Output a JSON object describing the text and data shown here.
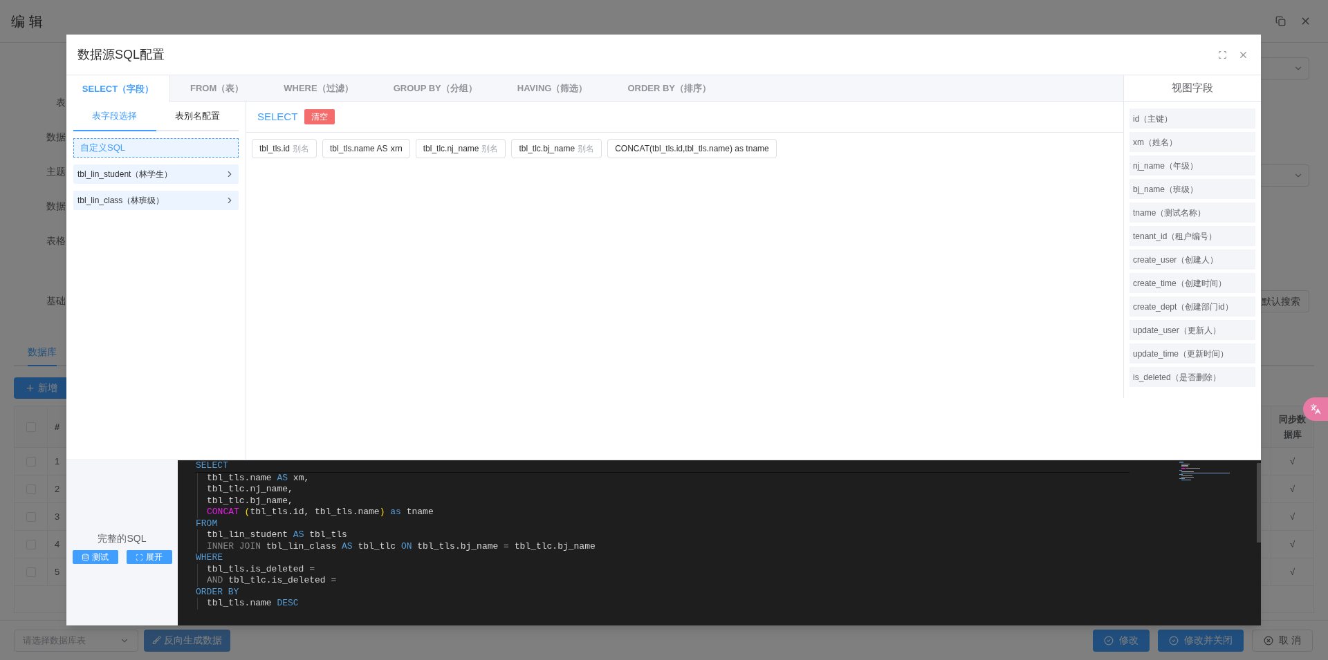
{
  "page": {
    "title": "编 辑",
    "form_labels": [
      "表",
      "数据",
      "主题",
      "数据",
      "表格",
      "基础"
    ],
    "default_search_button": "默认搜索",
    "tabs": [
      {
        "label": "数据库",
        "selected": true
      }
    ],
    "add_button": "新增",
    "table": {
      "header_checkbox": {
        "checked": false
      },
      "columns": [
        "#",
        "同步数据库"
      ],
      "rows": [
        {
          "checked": false,
          "number": "1",
          "sync": "√"
        },
        {
          "checked": false,
          "number": "2",
          "sync": "√"
        },
        {
          "checked": false,
          "number": "3",
          "sync": "√"
        },
        {
          "checked": false,
          "number": "4",
          "sync": "√"
        },
        {
          "checked": false,
          "number": "5",
          "sync": "√"
        }
      ]
    },
    "footer": {
      "table_select": {
        "placeholder": "请选择数据库表"
      },
      "reverse_button": {
        "label": "反向生成数据",
        "disabled": true
      },
      "buttons": [
        {
          "label": "修改",
          "kind": "primary"
        },
        {
          "label": "修改并关闭",
          "kind": "primary"
        },
        {
          "label": "取 消",
          "kind": "default"
        }
      ]
    }
  },
  "dialog": {
    "title": "数据源SQL配置",
    "tabs": [
      {
        "label": "SELECT（字段）",
        "selected": true
      },
      {
        "label": "FROM（表）",
        "selected": false
      },
      {
        "label": "WHERE（过滤）",
        "selected": false
      },
      {
        "label": "GROUP BY（分组）",
        "selected": false
      },
      {
        "label": "HAVING（筛选）",
        "selected": false
      },
      {
        "label": "ORDER BY（排序）",
        "selected": false
      }
    ],
    "sub_tabs": [
      {
        "label": "表字段选择",
        "selected": true
      },
      {
        "label": "表别名配置",
        "selected": false
      }
    ],
    "sources": [
      {
        "label": "自定义SQL",
        "kind": "custom"
      },
      {
        "label": "tbl_lin_student（林学生）",
        "kind": "table"
      },
      {
        "label": "tbl_lin_class（林班级）",
        "kind": "table"
      }
    ],
    "clause_label": "SELECT",
    "clear_button": "清空",
    "fields": [
      {
        "text": "tbl_tls.id",
        "placeholder": "别名"
      },
      {
        "text": "tbl_tls.name AS",
        "value": "xm"
      },
      {
        "text": "tbl_tlc.nj_name",
        "placeholder": "别名"
      },
      {
        "text": "tbl_tlc.bj_name",
        "placeholder": "别名"
      },
      {
        "text": "CONCAT(tbl_tls.id,tbl_tls.name) as tname"
      }
    ],
    "view_fields_title": "视图字段",
    "view_fields": [
      "id（主键）",
      "xm（姓名）",
      "nj_name（年级）",
      "bj_name（班级）",
      "tname（测试名称）",
      "tenant_id（租户编号）",
      "create_user（创建人）",
      "create_time（创建时间）",
      "create_dept（创建部门id）",
      "update_user（更新人）",
      "update_time（更新时间）",
      "is_deleted（是否删除）"
    ],
    "sql_title": "完整的SQL",
    "test_button": "测试",
    "expand_button": "展开",
    "sql": [
      {
        "keyword": "SELECT",
        "lines": [
          [
            {
              "text": "tbl_tls.name ",
              "kind": "plain"
            },
            {
              "text": "AS",
              "kind": "keyword"
            },
            {
              "text": " xm,",
              "kind": "plain"
            }
          ],
          [
            {
              "text": "tbl_tlc.nj_name,",
              "kind": "plain"
            }
          ],
          [
            {
              "text": "tbl_tlc.bj_name,",
              "kind": "plain"
            }
          ],
          [
            {
              "text": "CONCAT",
              "kind": "function"
            },
            {
              "text": " (",
              "kind": "paren"
            },
            {
              "text": "tbl_tls.id, tbl_tls.name",
              "kind": "plain"
            },
            {
              "text": ")",
              "kind": "paren"
            },
            {
              "text": " as",
              "kind": "keyword"
            },
            {
              "text": " tname",
              "kind": "plain"
            }
          ]
        ]
      },
      {
        "keyword": "FROM",
        "lines": [
          [
            {
              "text": "tbl_lin_student ",
              "kind": "plain"
            },
            {
              "text": "AS",
              "kind": "keyword"
            },
            {
              "text": " tbl_tls",
              "kind": "plain"
            }
          ],
          [
            {
              "text": "INNER JOIN",
              "kind": "dim"
            },
            {
              "text": " tbl_lin_class ",
              "kind": "plain"
            },
            {
              "text": "AS",
              "kind": "keyword"
            },
            {
              "text": " tbl_tlc ",
              "kind": "plain"
            },
            {
              "text": "ON",
              "kind": "keyword"
            },
            {
              "text": " tbl_tls.bj_name ",
              "kind": "plain"
            },
            {
              "text": "=",
              "kind": "operator"
            },
            {
              "text": " tbl_tlc.bj_name",
              "kind": "plain"
            }
          ]
        ]
      },
      {
        "keyword": "WHERE",
        "lines": [
          [
            {
              "text": "tbl_tls.is_deleted ",
              "kind": "plain"
            },
            {
              "text": "=",
              "kind": "operator"
            }
          ],
          [
            {
              "text": "AND",
              "kind": "dim"
            },
            {
              "text": " tbl_tlc.is_deleted ",
              "kind": "plain"
            },
            {
              "text": "=",
              "kind": "operator"
            }
          ]
        ]
      },
      {
        "keyword": "ORDER BY",
        "lines": [
          [
            {
              "text": "tbl_tls.name ",
              "kind": "plain"
            },
            {
              "text": "DESC",
              "kind": "keyword"
            }
          ]
        ]
      }
    ]
  }
}
